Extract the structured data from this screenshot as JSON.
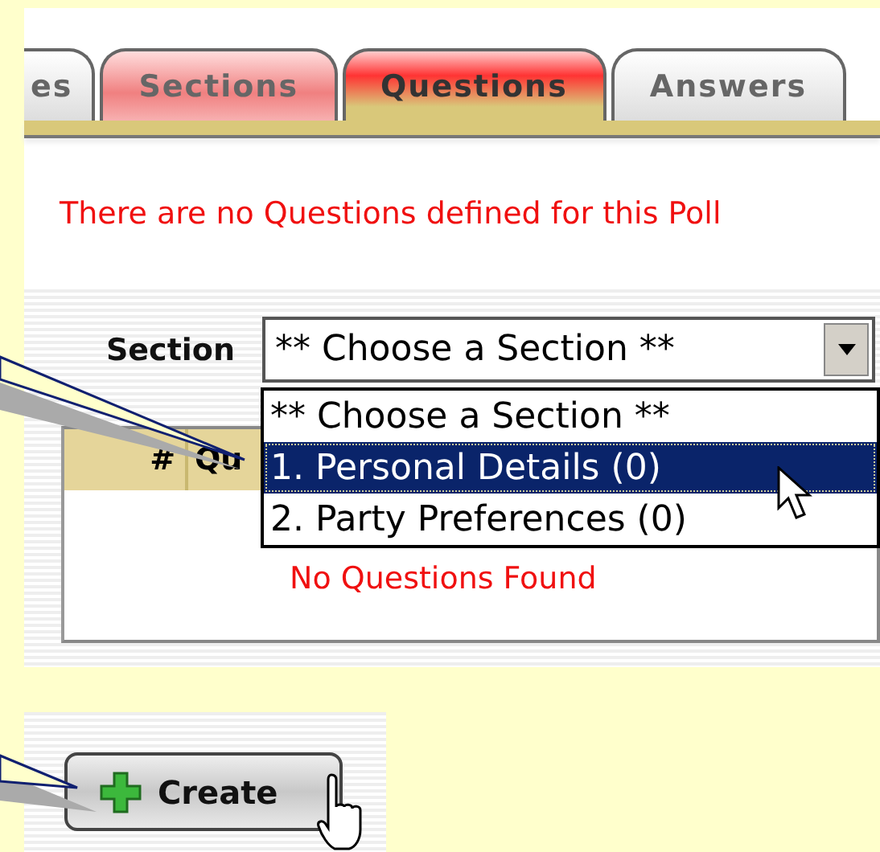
{
  "tabs": [
    {
      "label": "es",
      "kind": "plain",
      "selected": false
    },
    {
      "label": "Sections",
      "kind": "highlighted",
      "selected": false
    },
    {
      "label": "Questions",
      "kind": "highlighted",
      "selected": true
    },
    {
      "label": "Answers",
      "kind": "plain",
      "selected": false
    }
  ],
  "message": "There are no Questions defined for this Poll",
  "section_field": {
    "label": "Section",
    "value": "** Choose a Section **",
    "expanded": true
  },
  "dropdown_options": [
    {
      "label": "** Choose a Section **",
      "selected": false
    },
    {
      "label": "1. Personal Details (0)",
      "selected": true
    },
    {
      "label": "2. Party Preferences (0)",
      "selected": false
    }
  ],
  "table": {
    "columns": [
      "#",
      "Qu"
    ],
    "empty_message": "No Questions Found"
  },
  "create_button": {
    "label": "Create"
  }
}
